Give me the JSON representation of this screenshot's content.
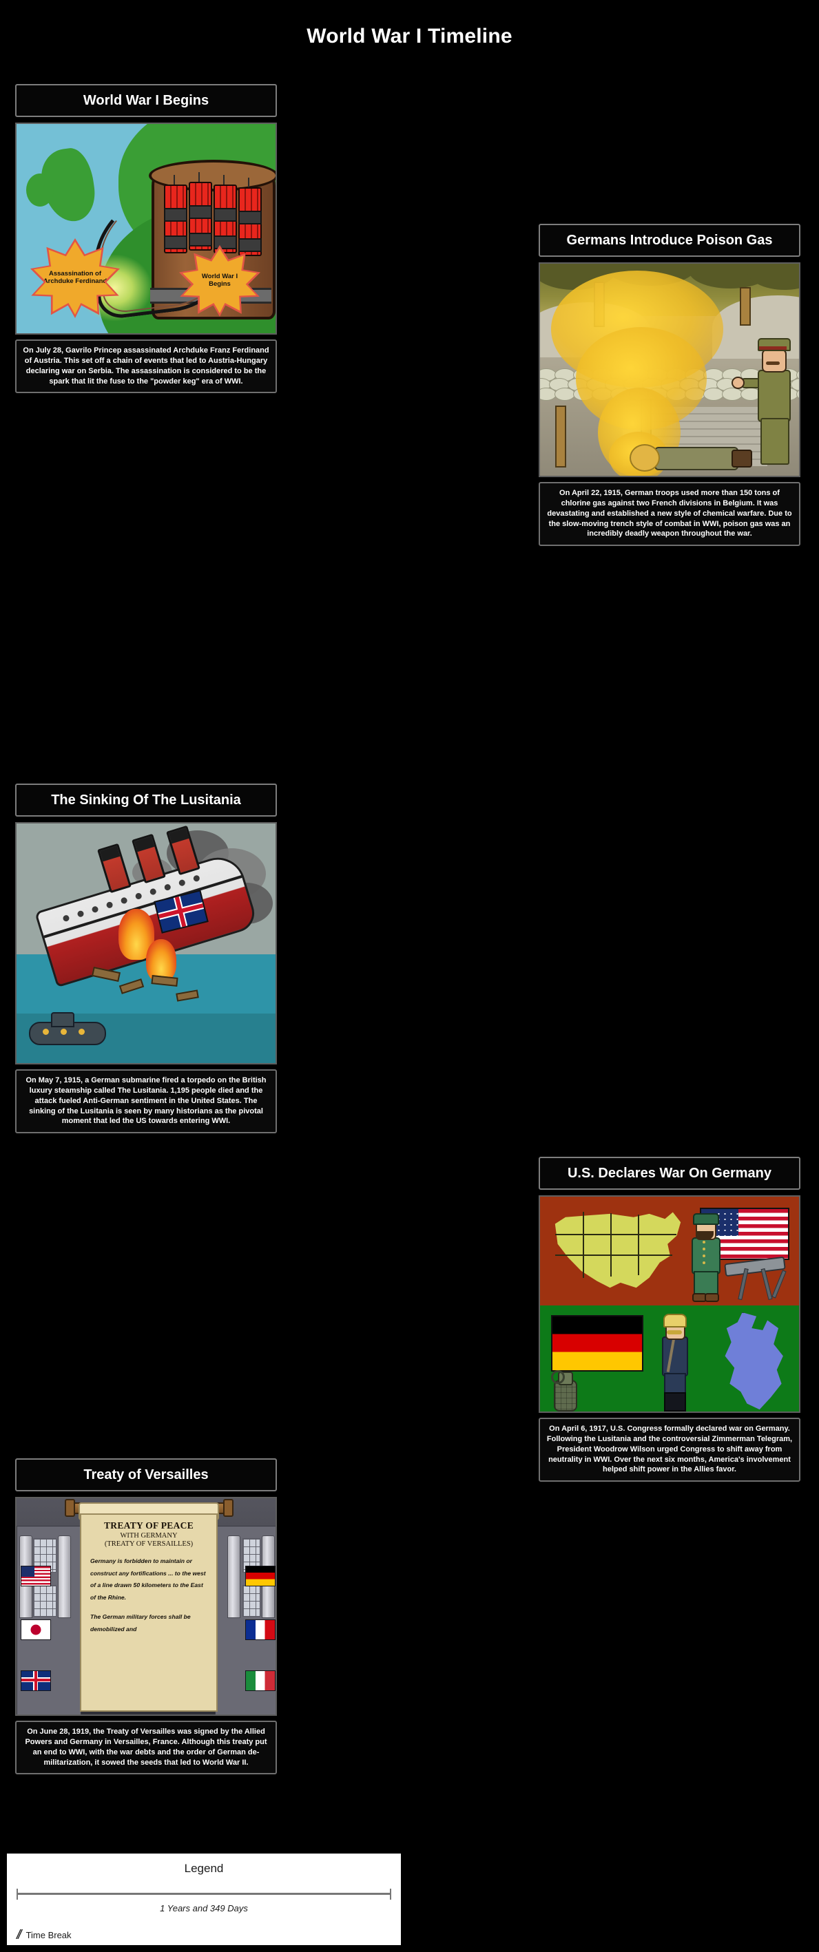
{
  "page": {
    "title": "World War I Timeline",
    "background_color": "#000000"
  },
  "cells": [
    {
      "id": "wwi-begins",
      "title": "World War I Begins",
      "caption": "On July 28, Gavrilo Princep assassinated Archduke Franz Ferdinand of Austria. This set off a chain of events that led to Austria-Hungary declaring war on Serbia. The assassination is considered to be the spark that lit the fuse to the \"powder keg\" era of WWI.",
      "art_labels": {
        "star_left": "Assassination of Archduke Ferdinand",
        "star_right": "World War I Begins"
      }
    },
    {
      "id": "poison-gas",
      "title": "Germans Introduce Poison Gas",
      "caption": "On April 22, 1915, German troops used more than 150 tons of chlorine gas against two French divisions in Belgium. It was devastating and established a new style of chemical warfare. Due to the slow-moving trench style of combat in WWI, poison gas was an incredibly deadly weapon throughout the war."
    },
    {
      "id": "lusitania",
      "title": "The Sinking Of The Lusitania",
      "caption": "On May 7, 1915, a German submarine fired a torpedo on the British luxury steamship called The Lusitania. 1,195 people died and the attack fueled Anti-German sentiment in the United States. The sinking of the Lusitania is seen by many historians as the pivotal moment that led the US towards entering WWI."
    },
    {
      "id": "us-declares-war",
      "title": "U.S. Declares War On Germany",
      "caption": "On April 6, 1917, U.S. Congress formally declared war on Germany. Following the Lusitania and the controversial Zimmerman Telegram, President Woodrow Wilson urged Congress to shift away from neutrality in WWI. Over the next six months, America's involvement helped shift power in the Allies favor."
    },
    {
      "id": "treaty-versailles",
      "title": "Treaty of Versailles",
      "caption": "On June 28, 1919, the Treaty of Versailles was signed by the Allied Powers and Germany in Versailles, France. Although this treaty put an end to WWI, with the war debts and the order of German de-militarization, it sowed the seeds that led to World War II.",
      "document": {
        "heading_line1": "TREATY OF PEACE",
        "heading_line2": "WITH GERMANY",
        "heading_line3": "(TREATY OF VERSAILLES)",
        "paragraph1": "Germany is forbidden to maintain or construct any fortifications ... to the west of a line drawn 50 kilometers to the East of the Rhine.",
        "paragraph2": "The German military forces shall be demobilized and"
      }
    }
  ],
  "legend": {
    "title": "Legend",
    "duration": "1 Years and 349 Days",
    "time_break_label": "Time Break",
    "time_break_glyph": "//"
  }
}
